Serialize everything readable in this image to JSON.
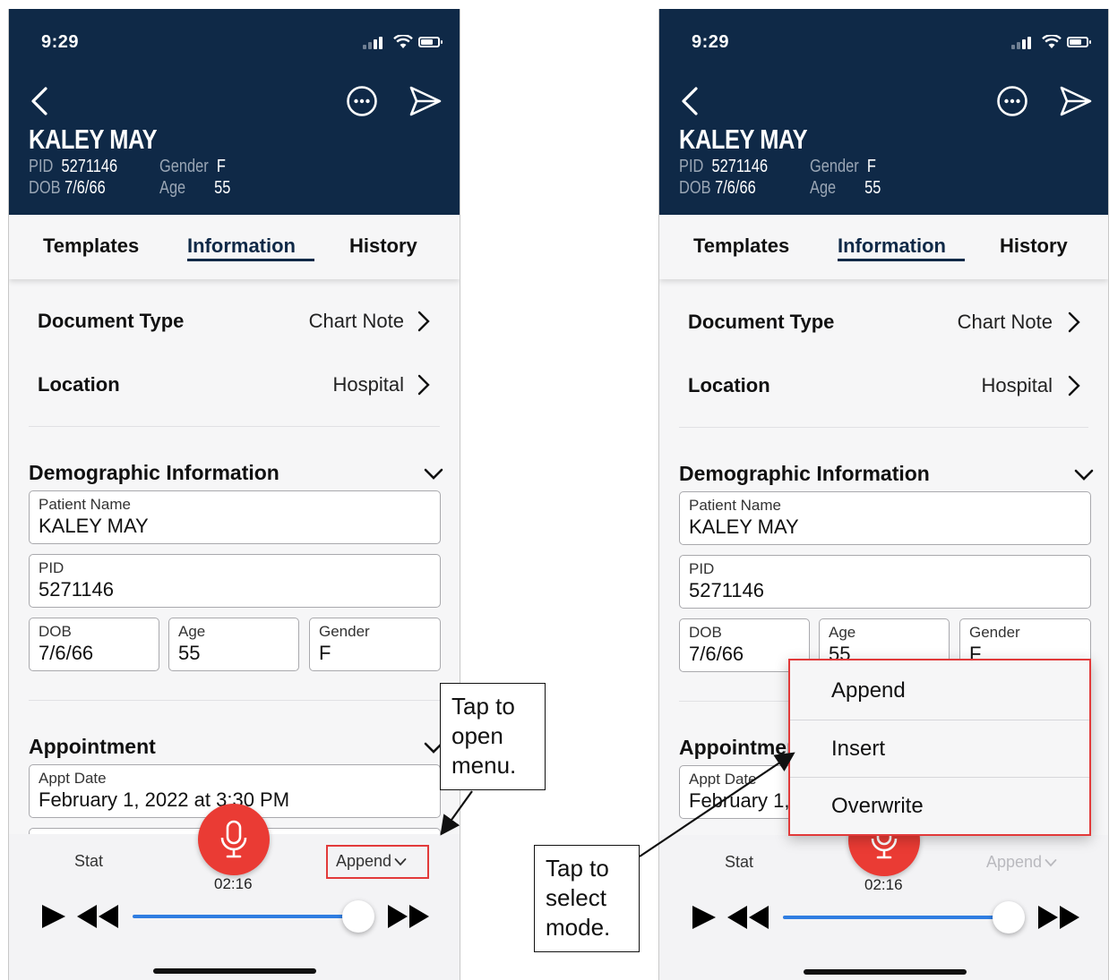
{
  "phones": [
    {
      "status": {
        "time": "9:29"
      },
      "header": {
        "patient_name": "KALEY MAY",
        "pid_label": "PID",
        "pid_value": "5271146",
        "dob_label": "DOB",
        "dob_value": "7/6/66",
        "gender_label": "Gender",
        "gender_value": "F",
        "age_label": "Age",
        "age_value": "55"
      },
      "tabs": [
        "Templates",
        "Information",
        "History"
      ],
      "active_tab": "Information",
      "rows": [
        {
          "label": "Document Type",
          "value": "Chart Note"
        },
        {
          "label": "Location",
          "value": "Hospital"
        }
      ],
      "demographics": {
        "title": "Demographic Information",
        "patient_name_label": "Patient Name",
        "patient_name_value": "KALEY MAY",
        "pid_label": "PID",
        "pid_value": "5271146",
        "dob_label": "DOB",
        "dob_value": "7/6/66",
        "age_label": "Age",
        "age_value": "55",
        "gender_label": "Gender",
        "gender_value": "F"
      },
      "appointment": {
        "title": "Appointment",
        "appt_date_label": "Appt Date",
        "appt_date_value": "February 1, 2022 at 3:30 PM"
      },
      "recorder": {
        "stat_label": "Stat",
        "mode_label": "Append",
        "timer": "02:16",
        "progress": 0.97
      }
    },
    {
      "status": {
        "time": "9:29"
      },
      "header": {
        "patient_name": "KALEY MAY",
        "pid_label": "PID",
        "pid_value": "5271146",
        "dob_label": "DOB",
        "dob_value": "7/6/66",
        "gender_label": "Gender",
        "gender_value": "F",
        "age_label": "Age",
        "age_value": "55"
      },
      "tabs": [
        "Templates",
        "Information",
        "History"
      ],
      "active_tab": "Information",
      "rows": [
        {
          "label": "Document Type",
          "value": "Chart Note"
        },
        {
          "label": "Location",
          "value": "Hospital"
        }
      ],
      "demographics": {
        "title": "Demographic Information",
        "patient_name_label": "Patient Name",
        "patient_name_value": "KALEY MAY",
        "pid_label": "PID",
        "pid_value": "5271146",
        "dob_label": "DOB",
        "dob_value": "7/6/66",
        "age_label": "Age",
        "age_value": "55",
        "gender_label": "Gender",
        "gender_value": "F"
      },
      "appointment": {
        "title": "Appointment",
        "appt_date_label": "Appt Date",
        "appt_date_value": "February 1, 2022 at 3:30 PM"
      },
      "recorder": {
        "stat_label": "Stat",
        "mode_label": "Append",
        "timer": "02:16",
        "progress": 0.97
      }
    }
  ],
  "mode_menu": {
    "items": [
      "Append",
      "Insert",
      "Overwrite"
    ]
  },
  "callouts": {
    "open_menu": [
      "Tap to",
      "open",
      "menu."
    ],
    "select_mode": [
      "Tap to",
      "select",
      "mode."
    ]
  },
  "colors": {
    "header_bg": "#0f2947",
    "record_button": "#ea3b34",
    "progress": "#2f7de1",
    "highlight_box": "#e23a3a"
  },
  "icons": [
    "back-chevron-icon",
    "more-options-icon",
    "send-icon",
    "signal-icon",
    "wifi-icon",
    "battery-icon",
    "chevron-right-icon",
    "chevron-down-icon",
    "microphone-icon",
    "play-icon",
    "rewind-icon",
    "fast-forward-icon"
  ]
}
